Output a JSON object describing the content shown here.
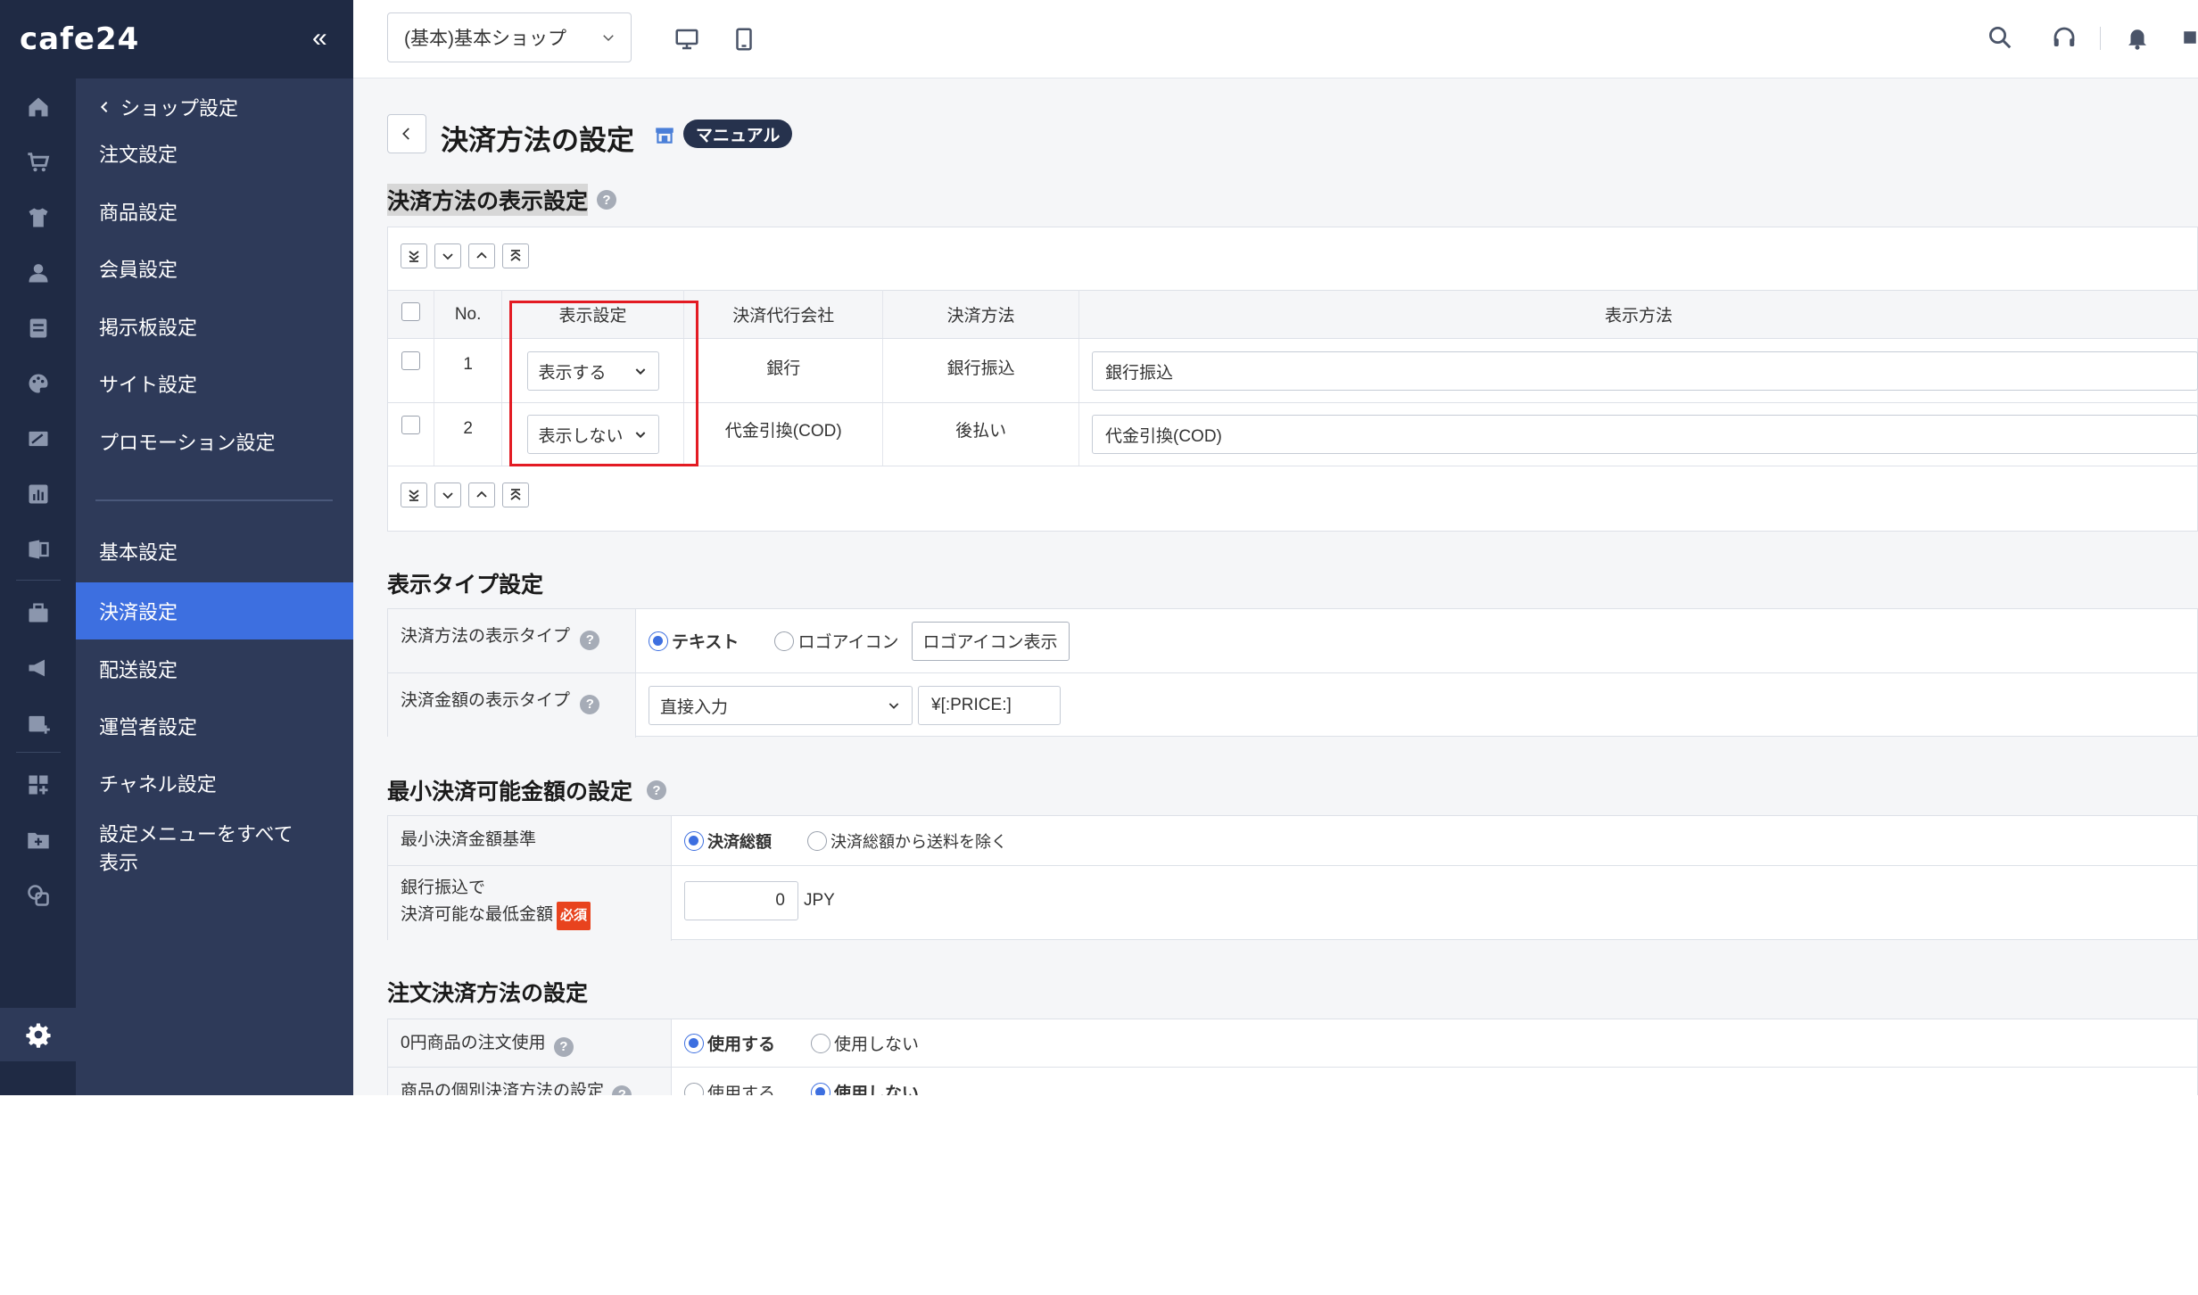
{
  "brand": {
    "logo": "cafe24",
    "collapse_icon": "«"
  },
  "side_menu": {
    "back_label": "ショップ設定",
    "items": [
      {
        "label": "注文設定"
      },
      {
        "label": "商品設定"
      },
      {
        "label": "会員設定"
      },
      {
        "label": "掲示板設定"
      },
      {
        "label": "サイト設定"
      },
      {
        "label": "プロモーション設定"
      },
      {
        "label": "基本設定"
      },
      {
        "label": "決済設定",
        "active": true
      },
      {
        "label": "配送設定"
      },
      {
        "label": "運営者設定"
      },
      {
        "label": "チャネル設定"
      },
      {
        "label": "設定メニューをすべて表示"
      }
    ]
  },
  "topbar": {
    "shop_select": "(基本)基本ショップ"
  },
  "page": {
    "title": "決済方法の設定",
    "manual_badge": "マニュアル"
  },
  "display_settings": {
    "title": "決済方法の表示設定",
    "columns": [
      "No.",
      "表示設定",
      "決済代行会社",
      "決済方法",
      "表示方法"
    ],
    "rows": [
      {
        "no": "1",
        "display": "表示する",
        "company": "銀行",
        "method": "銀行振込",
        "display_name": "銀行振込"
      },
      {
        "no": "2",
        "display": "表示しない",
        "company": "代金引換(COD)",
        "method": "後払い",
        "display_name": "代金引換(COD)"
      }
    ]
  },
  "display_type": {
    "title": "表示タイプ設定",
    "row1_label": "決済方法の表示タイプ",
    "row1_opt_text": "テキスト",
    "row1_opt_logo": "ロゴアイコン",
    "row1_button": "ロゴアイコン表示",
    "row2_label": "決済金額の表示タイプ",
    "row2_select": "直接入力",
    "row2_input": "¥[:PRICE:]"
  },
  "min_amount": {
    "title": "最小決済可能金額の設定",
    "row1_label": "最小決済金額基準",
    "row1_opt_total": "決済総額",
    "row1_opt_excl": "決済総額から送料を除く",
    "row2_label_line1": "銀行振込で",
    "row2_label_line2": "決済可能な最低金額",
    "row2_required": "必須",
    "row2_value": "0",
    "row2_unit": "JPY"
  },
  "order_payment": {
    "title": "注文決済方法の設定",
    "row1_label": "0円商品の注文使用",
    "row1_opt_use": "使用する",
    "row1_opt_nouse": "使用しない",
    "row2_label": "商品の個別決済方法の設定",
    "row2_opt_use": "使用する",
    "row2_opt_nouse": "使用しない"
  }
}
